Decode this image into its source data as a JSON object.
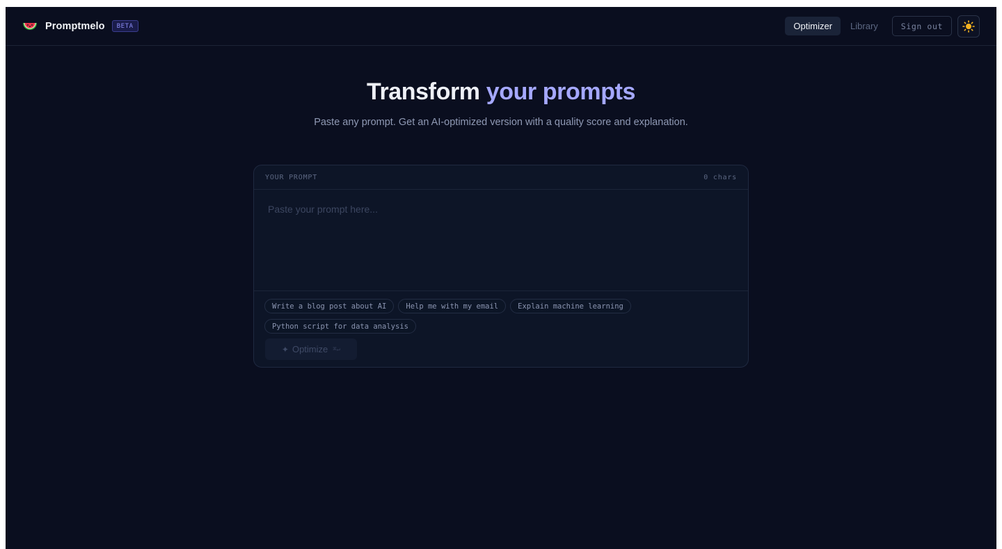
{
  "header": {
    "brand_name": "Promptmelo",
    "badge": "BETA",
    "nav": [
      {
        "label": "Optimizer",
        "active": true
      },
      {
        "label": "Library",
        "active": false
      }
    ],
    "sign_out": "Sign out",
    "theme_icon": "sun-icon"
  },
  "hero": {
    "title_main": "Transform",
    "title_accent": "your prompts",
    "subtitle": "Paste any prompt. Get an AI-optimized version with a quality score and explanation."
  },
  "card": {
    "label": "YOUR PROMPT",
    "char_count": "0 chars",
    "input_value": "",
    "placeholder": "Paste your prompt here...",
    "suggestions": [
      "Write a blog post about AI",
      "Help me with my email",
      "Explain machine learning",
      "Python script for data analysis"
    ],
    "optimize_label": "Optimize",
    "optimize_shortcut": "⌘↵"
  },
  "colors": {
    "background": "#0a0e1f",
    "accent": "#a5a8ff",
    "card": "#0d1527"
  }
}
